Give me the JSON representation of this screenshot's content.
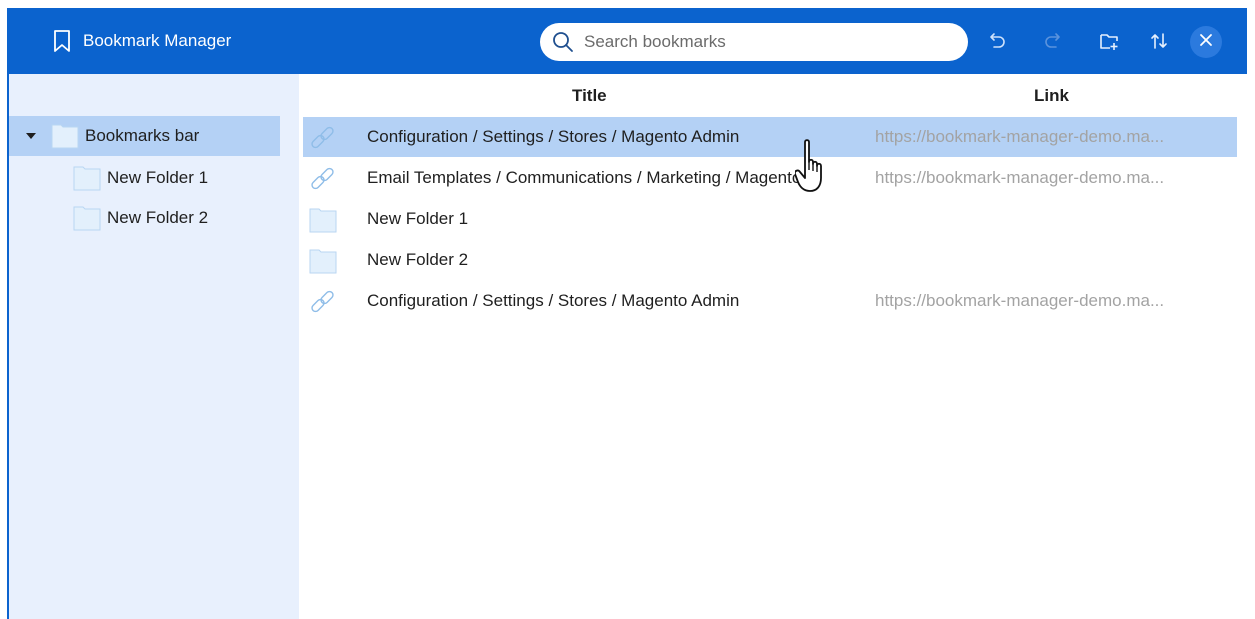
{
  "app": {
    "title": "Bookmark Manager"
  },
  "search": {
    "placeholder": "Search bookmarks",
    "value": ""
  },
  "toolbar": {
    "undo": "undo-icon",
    "redo": "redo-icon",
    "new_folder": "new-folder-icon",
    "sort": "sort-icon",
    "close": "close-icon"
  },
  "colors": {
    "header_bg": "#0b63ce",
    "sidebar_bg": "#e8f0fd",
    "selected_bg": "#b4d1f5",
    "link_text": "#a3a3a3",
    "folder_fill": "#e3f0fc"
  },
  "sidebar": {
    "items": [
      {
        "label": "Bookmarks bar",
        "expanded": true,
        "selected": true
      },
      {
        "label": "New Folder 1"
      },
      {
        "label": "New Folder 2"
      }
    ]
  },
  "table": {
    "columns": [
      "Title",
      "Link"
    ],
    "rows": [
      {
        "type": "link",
        "title": "Configuration / Settings / Stores / Magento Admin",
        "link": "https://bookmark-manager-demo.ma...",
        "selected": true
      },
      {
        "type": "link",
        "title": "Email Templates / Communications / Marketing / Magento...",
        "link": "https://bookmark-manager-demo.ma..."
      },
      {
        "type": "folder",
        "title": "New Folder 1",
        "link": ""
      },
      {
        "type": "folder",
        "title": "New Folder 2",
        "link": ""
      },
      {
        "type": "link",
        "title": "Configuration / Settings / Stores / Magento Admin",
        "link": "https://bookmark-manager-demo.ma..."
      }
    ]
  }
}
